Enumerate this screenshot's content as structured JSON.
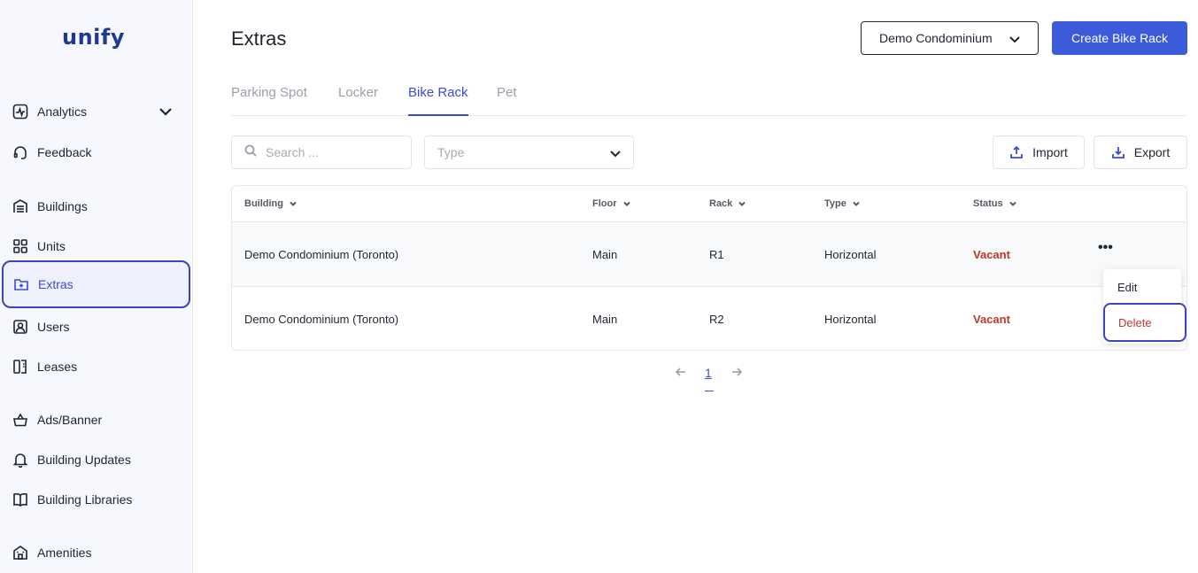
{
  "app": {
    "logo": "unify"
  },
  "sidebar": {
    "items": [
      {
        "label": "Analytics",
        "icon": "pulse-chart-icon"
      },
      {
        "label": "Feedback",
        "icon": "headset-icon"
      },
      {
        "label": "Buildings",
        "icon": "garage-icon"
      },
      {
        "label": "Units",
        "icon": "grid-icon"
      },
      {
        "label": "Extras",
        "icon": "folder-plus-icon",
        "active": true
      },
      {
        "label": "Users",
        "icon": "user-badge-icon"
      },
      {
        "label": "Leases",
        "icon": "document-icon"
      },
      {
        "label": "Ads/Banner",
        "icon": "basket-icon"
      },
      {
        "label": "Building Updates",
        "icon": "bell-icon"
      },
      {
        "label": "Building Libraries",
        "icon": "book-icon"
      },
      {
        "label": "Amenities",
        "icon": "building-icon"
      }
    ]
  },
  "header": {
    "title": "Extras",
    "building_select": "Demo Condominium",
    "create_label": "Create Bike Rack"
  },
  "tabs": [
    {
      "label": "Parking Spot"
    },
    {
      "label": "Locker"
    },
    {
      "label": "Bike Rack",
      "active": true
    },
    {
      "label": "Pet"
    }
  ],
  "filters": {
    "search_placeholder": "Search ...",
    "type_placeholder": "Type",
    "import_label": "Import",
    "export_label": "Export"
  },
  "table": {
    "columns": [
      "Building",
      "Floor",
      "Rack",
      "Type",
      "Status"
    ],
    "rows": [
      {
        "building": "Demo Condominium (Toronto)",
        "floor": "Main",
        "rack": "R1",
        "type": "Horizontal",
        "status": "Vacant"
      },
      {
        "building": "Demo Condominium (Toronto)",
        "floor": "Main",
        "rack": "R2",
        "type": "Horizontal",
        "status": "Vacant"
      }
    ]
  },
  "row_menu": {
    "edit": "Edit",
    "delete": "Delete"
  },
  "pagination": {
    "current": "1"
  },
  "colors": {
    "accent": "#3b5bdb",
    "status_vacant": "#b8392b",
    "highlight_border": "#3b44b8"
  }
}
